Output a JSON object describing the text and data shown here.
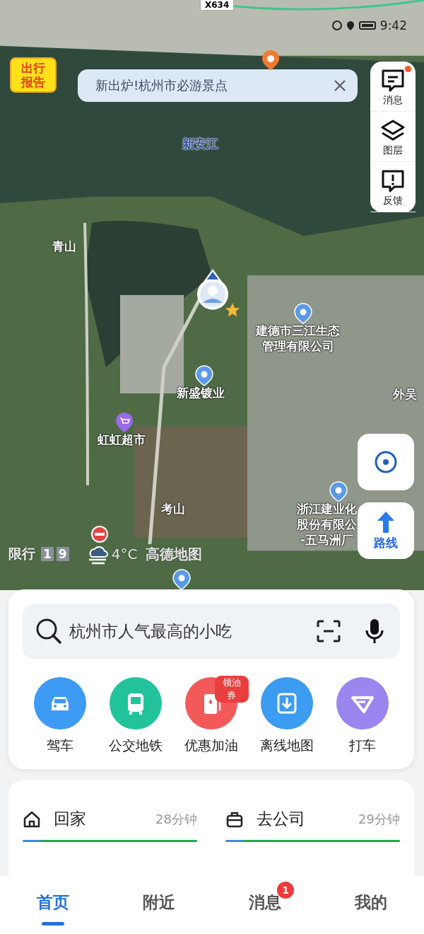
{
  "status_bar": {
    "time": "9:42"
  },
  "map": {
    "road_label": "X634",
    "report_badge": [
      "出行",
      "报告"
    ],
    "banner": {
      "text": "新出炉!杭州市必游景点"
    },
    "labels": [
      {
        "lines": [
          "新安江"
        ],
        "kind": "water"
      },
      {
        "lines": [
          "青山"
        ],
        "kind": "place"
      },
      {
        "lines": [
          "建德市三江生态",
          "管理有限公司"
        ],
        "kind": "place"
      },
      {
        "lines": [
          "新盛镀业"
        ],
        "kind": "place"
      },
      {
        "lines": [
          "虹虹超市"
        ],
        "kind": "place"
      },
      {
        "lines": [
          "考山"
        ],
        "kind": "place"
      },
      {
        "lines": [
          "外吴"
        ],
        "kind": "place"
      },
      {
        "lines": [
          "浙江建业化",
          "股份有限公",
          "-五马洲厂"
        ],
        "kind": "place"
      }
    ],
    "restriction": {
      "label": "限行",
      "digits": [
        "1",
        "9"
      ]
    },
    "weather": {
      "temperature": "4°C"
    },
    "brand": "高德地图"
  },
  "side_tools": [
    {
      "label": "消息",
      "kind": "message",
      "dot": true
    },
    {
      "label": "图层",
      "kind": "layers",
      "dot": false
    },
    {
      "label": "反馈",
      "kind": "feedback",
      "dot": false
    }
  ],
  "route_button": {
    "label": "路线"
  },
  "search": {
    "placeholder": "杭州市人气最高的小吃"
  },
  "shortcuts": [
    {
      "label": "驾车",
      "kind": "car",
      "color": "#3d9af5"
    },
    {
      "label": "公交地铁",
      "kind": "bus",
      "color": "#22c39a"
    },
    {
      "label": "优惠加油",
      "kind": "fuel",
      "color": "#f25a5a",
      "badge": "领油券"
    },
    {
      "label": "离线地图",
      "kind": "download",
      "color": "#3c9cf2"
    },
    {
      "label": "打车",
      "kind": "taxi",
      "color": "#9a86ee"
    }
  ],
  "commutes": [
    {
      "kind": "home",
      "label": "回家",
      "duration": "28分钟"
    },
    {
      "kind": "work",
      "label": "去公司",
      "duration": "29分钟"
    }
  ],
  "tabs": [
    {
      "label": "首页",
      "selected": true
    },
    {
      "label": "附近",
      "selected": false
    },
    {
      "label": "消息",
      "selected": false,
      "badge": "1"
    },
    {
      "label": "我的",
      "selected": false
    }
  ]
}
